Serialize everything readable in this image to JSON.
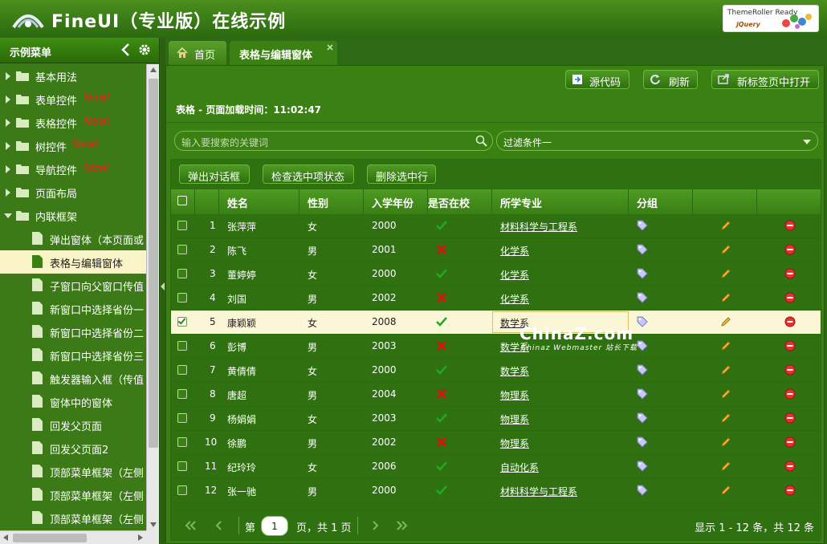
{
  "header": {
    "title": "FineUI（专业版）在线示例",
    "badge_line1": "ThemeRoller Ready",
    "badge_line2": "jQuery"
  },
  "sidebar": {
    "title": "示例菜单",
    "new_label": "New!",
    "items": [
      {
        "label": "基本用法",
        "type": "folder",
        "expanded": false,
        "new": false
      },
      {
        "label": "表单控件",
        "type": "folder",
        "expanded": false,
        "new": true
      },
      {
        "label": "表格控件",
        "type": "folder",
        "expanded": false,
        "new": true
      },
      {
        "label": "树控件",
        "type": "folder",
        "expanded": false,
        "new": true
      },
      {
        "label": "导航控件",
        "type": "folder",
        "expanded": false,
        "new": true
      },
      {
        "label": "页面布局",
        "type": "folder",
        "expanded": false,
        "new": false
      },
      {
        "label": "内联框架",
        "type": "folder",
        "expanded": true,
        "new": false
      },
      {
        "label": "弹出窗体（本页面或",
        "type": "page"
      },
      {
        "label": "表格与编辑窗体",
        "type": "page",
        "selected": true
      },
      {
        "label": "子窗口向父窗口传值",
        "type": "page"
      },
      {
        "label": "新窗口中选择省份一",
        "type": "page"
      },
      {
        "label": "新窗口中选择省份二",
        "type": "page"
      },
      {
        "label": "新窗口中选择省份三",
        "type": "page"
      },
      {
        "label": "触发器输入框（传值",
        "type": "page"
      },
      {
        "label": "窗体中的窗体",
        "type": "page"
      },
      {
        "label": "回发父页面",
        "type": "page"
      },
      {
        "label": "回发父页面2",
        "type": "page"
      },
      {
        "label": "顶部菜单框架（左侧",
        "type": "page"
      },
      {
        "label": "顶部菜单框架（左侧",
        "type": "page"
      },
      {
        "label": "顶部菜单框架（左侧",
        "type": "page"
      }
    ]
  },
  "tabs": {
    "home": "首页",
    "active": "表格与编辑窗体"
  },
  "toolbar": {
    "source": "源代码",
    "refresh": "刷新",
    "open_new": "新标签页中打开"
  },
  "panel": {
    "subtitle": "表格 - 页面加载时间：11:02:47"
  },
  "search": {
    "placeholder": "输入要搜索的关键词"
  },
  "filter": {
    "value": "过滤条件一"
  },
  "grid": {
    "buttons": {
      "dialog": "弹出对话框",
      "check": "检查选中项状态",
      "delete": "删除选中行"
    },
    "columns": {
      "name": "姓名",
      "gender": "性别",
      "year": "入学年份",
      "enrolled": "是否在校",
      "major": "所学专业",
      "group": "分组"
    },
    "rows": [
      {
        "no": "1",
        "name": "张萍萍",
        "gender": "女",
        "year": "2000",
        "enrolled": true,
        "major": "材料科学与工程系"
      },
      {
        "no": "2",
        "name": "陈飞",
        "gender": "男",
        "year": "2001",
        "enrolled": false,
        "major": "化学系"
      },
      {
        "no": "3",
        "name": "董婷婷",
        "gender": "女",
        "year": "2000",
        "enrolled": true,
        "major": "化学系"
      },
      {
        "no": "4",
        "name": "刘国",
        "gender": "男",
        "year": "2002",
        "enrolled": false,
        "major": "化学系"
      },
      {
        "no": "5",
        "name": "康颖颖",
        "gender": "女",
        "year": "2008",
        "enrolled": true,
        "major": "数学系",
        "selected": true
      },
      {
        "no": "6",
        "name": "彭博",
        "gender": "男",
        "year": "2003",
        "enrolled": false,
        "major": "数学系"
      },
      {
        "no": "7",
        "name": "黄倩倩",
        "gender": "女",
        "year": "2000",
        "enrolled": true,
        "major": "数学系"
      },
      {
        "no": "8",
        "name": "唐超",
        "gender": "男",
        "year": "2004",
        "enrolled": false,
        "major": "物理系"
      },
      {
        "no": "9",
        "name": "杨娟娟",
        "gender": "女",
        "year": "2003",
        "enrolled": true,
        "major": "物理系"
      },
      {
        "no": "10",
        "name": "徐鹏",
        "gender": "男",
        "year": "2002",
        "enrolled": false,
        "major": "物理系"
      },
      {
        "no": "11",
        "name": "纪玲玲",
        "gender": "女",
        "year": "2006",
        "enrolled": true,
        "major": "自动化系"
      },
      {
        "no": "12",
        "name": "张一驰",
        "gender": "男",
        "year": "2000",
        "enrolled": true,
        "major": "材料科学与工程系"
      }
    ]
  },
  "pager": {
    "page_prefix": "第",
    "page_value": "1",
    "page_suffix": "页，共 1 页",
    "summary": "显示 1 - 12 条，共 12 条"
  },
  "watermark": {
    "main": "ChinaZ.com",
    "sub": "Chinaz Webmaster 站长下载"
  },
  "colors": {
    "bg": "#2e6a14",
    "accent": "#3a8012",
    "new": "#ff1a1a",
    "selected_row": "#fbf6d6",
    "check": "#1e9a1e",
    "cross": "#e01010"
  }
}
